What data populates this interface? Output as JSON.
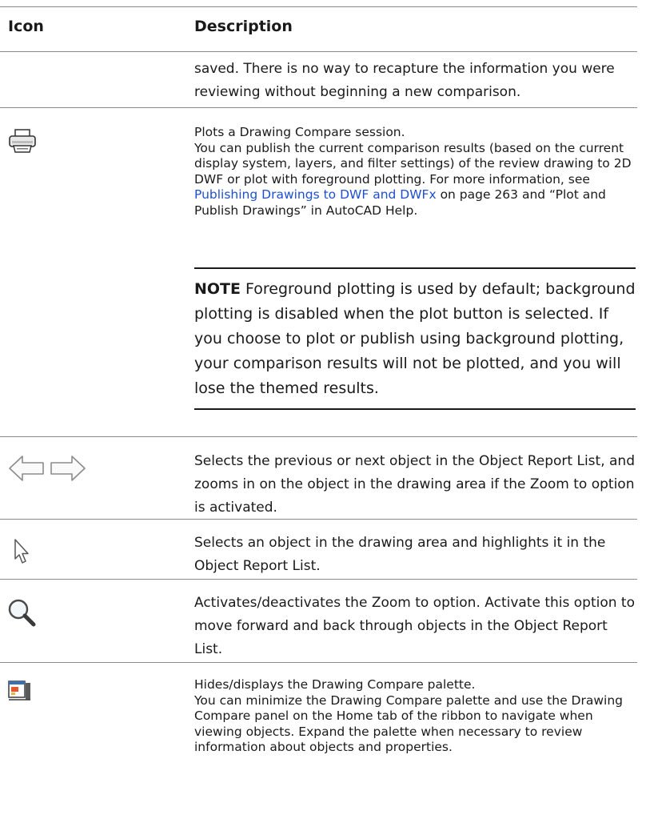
{
  "table": {
    "headers": {
      "icon": "Icon",
      "description": "Description"
    },
    "continued": {
      "text": "saved. There is no way to recapture the information you were reviewing without beginning a new comparison."
    },
    "plot": {
      "icon": "printer-icon",
      "line1": "Plots a Drawing Compare session.",
      "body_before_link": "You can publish the current comparison results (based on the current display system, layers, and filter settings) of the review drawing to 2D DWF or plot with foreground plotting. For more information, see ",
      "link": "Publishing Drawings to DWF and DWFx",
      "body_after_link": " on page 263 and “Plot and Publish Drawings” in AutoCAD Help.",
      "note_label": "NOTE",
      "note_text": " Foreground plotting is used by default; background plotting is disabled when the plot button is selected. If you choose to plot or publish using background plotting, your comparison results will not be plotted, and you will lose the themed results."
    },
    "navigate": {
      "icon": "previous-next-arrows-icon",
      "text": "Selects the previous or next object in the Object Report List, and zooms in on the object in the drawing area if the Zoom to option is activated."
    },
    "select": {
      "icon": "select-cursor-icon",
      "text": "Selects an object in the drawing area and highlights it in the Object Report List."
    },
    "zoom": {
      "icon": "magnifier-icon",
      "text": "Activates/deactivates the Zoom to option. Activate this option to move forward and back through objects in the Object Report List."
    },
    "palette": {
      "icon": "palette-toggle-icon",
      "line1": "Hides/displays the Drawing Compare palette.",
      "body": "You can minimize the Drawing Compare palette and use the Drawing Compare panel on the Home tab of the ribbon to navigate when viewing objects. Expand the palette when necessary to review information about objects and properties."
    }
  }
}
